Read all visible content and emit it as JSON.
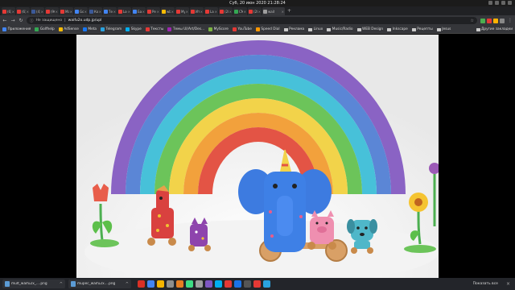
{
  "system_bar": {
    "clock": "Суб, 20 июн 2020 21:28:24"
  },
  "tabs": [
    {
      "label": "(6) In",
      "color": "#e53935"
    },
    {
      "label": "(6) I",
      "color": "#e53935"
    },
    {
      "label": "(4) I",
      "color": "#3b5998"
    },
    {
      "label": "(96)",
      "color": "#e53935"
    },
    {
      "label": "Mail",
      "color": "#e53935"
    },
    {
      "label": "Goo",
      "color": "#4285f4"
    },
    {
      "label": "Конт",
      "color": "#3b5998"
    },
    {
      "label": "Текс",
      "color": "#4285f4"
    },
    {
      "label": "Logo",
      "color": "#e53935"
    },
    {
      "label": "Базо",
      "color": "#4285f4"
    },
    {
      "label": "Ресу",
      "color": "#e53935"
    },
    {
      "label": "wbp",
      "color": "#fbbc05"
    },
    {
      "label": "Музі",
      "color": "#e53935"
    },
    {
      "label": "Итак",
      "color": "#e53935"
    },
    {
      "label": "Larn",
      "color": "#e53935"
    },
    {
      "label": "(28)",
      "color": "#e53935"
    },
    {
      "label": "СМ",
      "color": "#34a853"
    },
    {
      "label": "(28)",
      "color": "#e53935"
    },
    {
      "label": "wait",
      "color": "#9e9e9e",
      "active": true
    }
  ],
  "address_bar": {
    "not_secure": "Не защищено",
    "url": "waifu2x.udp.jp/upl"
  },
  "bookmarks": [
    {
      "label": "Приложения",
      "color": "#4285f4"
    },
    {
      "label": "Golfhelp",
      "color": "#34a853"
    },
    {
      "label": "AdSense",
      "color": "#fbbc05"
    },
    {
      "label": "Меta",
      "color": "#1877f2"
    },
    {
      "label": "Telegram",
      "color": "#2aa3e0"
    },
    {
      "label": "Skype",
      "color": "#00aff0"
    },
    {
      "label": "Тексты",
      "color": "#e53935"
    },
    {
      "label": "Темы UI/Art/Des...",
      "color": "#9c27b0"
    },
    {
      "label": "MyScore",
      "color": "#7cb342"
    },
    {
      "label": "YouTube",
      "color": "#e53935"
    },
    {
      "label": "Speed Dial",
      "color": "#ff9800"
    },
    {
      "label": "Реклама",
      "color": "",
      "folder": true
    },
    {
      "label": "Linux",
      "color": "",
      "folder": true
    },
    {
      "label": "Music/Radio",
      "color": "",
      "folder": true
    },
    {
      "label": "WEB Design",
      "color": "",
      "folder": true
    },
    {
      "label": "Inkscape",
      "color": "",
      "folder": true
    },
    {
      "label": "Рецепты",
      "color": "",
      "folder": true
    },
    {
      "label": "Jesus",
      "color": "",
      "folder": true
    }
  ],
  "other_bookmarks": "Другие закладки",
  "downloads": [
    {
      "name": "mult_waifu2x_....png"
    },
    {
      "name": "mupec_waifu2x....png"
    }
  ],
  "show_all": "Показать все",
  "dock_colors": [
    "#d93025",
    "#4285f4",
    "#f4b400",
    "#8e8e8e",
    "#e67e22",
    "#3ddc84",
    "#9e9e9e",
    "#7e57c2",
    "#00aff0",
    "#e53935",
    "#1a73e8",
    "#555555",
    "#e53935",
    "#2aa3e0"
  ]
}
